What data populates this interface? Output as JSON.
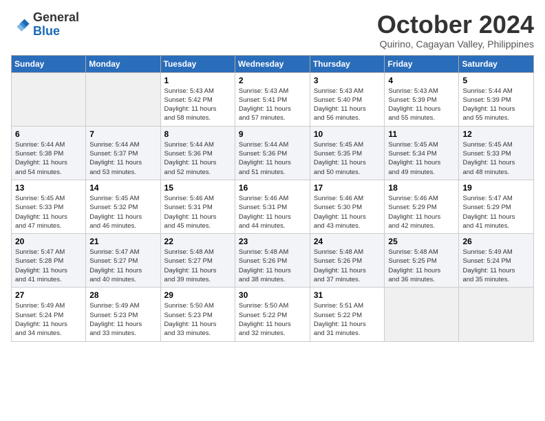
{
  "header": {
    "logo_line1": "General",
    "logo_line2": "Blue",
    "month": "October 2024",
    "location": "Quirino, Cagayan Valley, Philippines"
  },
  "weekdays": [
    "Sunday",
    "Monday",
    "Tuesday",
    "Wednesday",
    "Thursday",
    "Friday",
    "Saturday"
  ],
  "weeks": [
    [
      {
        "day": "",
        "info": ""
      },
      {
        "day": "",
        "info": ""
      },
      {
        "day": "1",
        "info": "Sunrise: 5:43 AM\nSunset: 5:42 PM\nDaylight: 11 hours\nand 58 minutes."
      },
      {
        "day": "2",
        "info": "Sunrise: 5:43 AM\nSunset: 5:41 PM\nDaylight: 11 hours\nand 57 minutes."
      },
      {
        "day": "3",
        "info": "Sunrise: 5:43 AM\nSunset: 5:40 PM\nDaylight: 11 hours\nand 56 minutes."
      },
      {
        "day": "4",
        "info": "Sunrise: 5:43 AM\nSunset: 5:39 PM\nDaylight: 11 hours\nand 55 minutes."
      },
      {
        "day": "5",
        "info": "Sunrise: 5:44 AM\nSunset: 5:39 PM\nDaylight: 11 hours\nand 55 minutes."
      }
    ],
    [
      {
        "day": "6",
        "info": "Sunrise: 5:44 AM\nSunset: 5:38 PM\nDaylight: 11 hours\nand 54 minutes."
      },
      {
        "day": "7",
        "info": "Sunrise: 5:44 AM\nSunset: 5:37 PM\nDaylight: 11 hours\nand 53 minutes."
      },
      {
        "day": "8",
        "info": "Sunrise: 5:44 AM\nSunset: 5:36 PM\nDaylight: 11 hours\nand 52 minutes."
      },
      {
        "day": "9",
        "info": "Sunrise: 5:44 AM\nSunset: 5:36 PM\nDaylight: 11 hours\nand 51 minutes."
      },
      {
        "day": "10",
        "info": "Sunrise: 5:45 AM\nSunset: 5:35 PM\nDaylight: 11 hours\nand 50 minutes."
      },
      {
        "day": "11",
        "info": "Sunrise: 5:45 AM\nSunset: 5:34 PM\nDaylight: 11 hours\nand 49 minutes."
      },
      {
        "day": "12",
        "info": "Sunrise: 5:45 AM\nSunset: 5:33 PM\nDaylight: 11 hours\nand 48 minutes."
      }
    ],
    [
      {
        "day": "13",
        "info": "Sunrise: 5:45 AM\nSunset: 5:33 PM\nDaylight: 11 hours\nand 47 minutes."
      },
      {
        "day": "14",
        "info": "Sunrise: 5:45 AM\nSunset: 5:32 PM\nDaylight: 11 hours\nand 46 minutes."
      },
      {
        "day": "15",
        "info": "Sunrise: 5:46 AM\nSunset: 5:31 PM\nDaylight: 11 hours\nand 45 minutes."
      },
      {
        "day": "16",
        "info": "Sunrise: 5:46 AM\nSunset: 5:31 PM\nDaylight: 11 hours\nand 44 minutes."
      },
      {
        "day": "17",
        "info": "Sunrise: 5:46 AM\nSunset: 5:30 PM\nDaylight: 11 hours\nand 43 minutes."
      },
      {
        "day": "18",
        "info": "Sunrise: 5:46 AM\nSunset: 5:29 PM\nDaylight: 11 hours\nand 42 minutes."
      },
      {
        "day": "19",
        "info": "Sunrise: 5:47 AM\nSunset: 5:29 PM\nDaylight: 11 hours\nand 41 minutes."
      }
    ],
    [
      {
        "day": "20",
        "info": "Sunrise: 5:47 AM\nSunset: 5:28 PM\nDaylight: 11 hours\nand 41 minutes."
      },
      {
        "day": "21",
        "info": "Sunrise: 5:47 AM\nSunset: 5:27 PM\nDaylight: 11 hours\nand 40 minutes."
      },
      {
        "day": "22",
        "info": "Sunrise: 5:48 AM\nSunset: 5:27 PM\nDaylight: 11 hours\nand 39 minutes."
      },
      {
        "day": "23",
        "info": "Sunrise: 5:48 AM\nSunset: 5:26 PM\nDaylight: 11 hours\nand 38 minutes."
      },
      {
        "day": "24",
        "info": "Sunrise: 5:48 AM\nSunset: 5:26 PM\nDaylight: 11 hours\nand 37 minutes."
      },
      {
        "day": "25",
        "info": "Sunrise: 5:48 AM\nSunset: 5:25 PM\nDaylight: 11 hours\nand 36 minutes."
      },
      {
        "day": "26",
        "info": "Sunrise: 5:49 AM\nSunset: 5:24 PM\nDaylight: 11 hours\nand 35 minutes."
      }
    ],
    [
      {
        "day": "27",
        "info": "Sunrise: 5:49 AM\nSunset: 5:24 PM\nDaylight: 11 hours\nand 34 minutes."
      },
      {
        "day": "28",
        "info": "Sunrise: 5:49 AM\nSunset: 5:23 PM\nDaylight: 11 hours\nand 33 minutes."
      },
      {
        "day": "29",
        "info": "Sunrise: 5:50 AM\nSunset: 5:23 PM\nDaylight: 11 hours\nand 33 minutes."
      },
      {
        "day": "30",
        "info": "Sunrise: 5:50 AM\nSunset: 5:22 PM\nDaylight: 11 hours\nand 32 minutes."
      },
      {
        "day": "31",
        "info": "Sunrise: 5:51 AM\nSunset: 5:22 PM\nDaylight: 11 hours\nand 31 minutes."
      },
      {
        "day": "",
        "info": ""
      },
      {
        "day": "",
        "info": ""
      }
    ]
  ]
}
